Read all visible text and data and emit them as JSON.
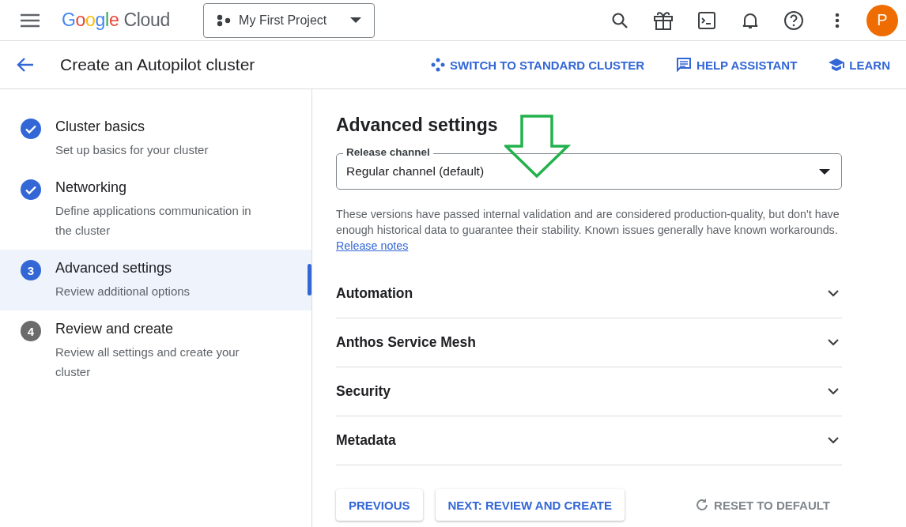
{
  "topbar": {
    "logo": {
      "brand": "Google",
      "product": "Cloud"
    },
    "project": "My First Project",
    "avatar": "P"
  },
  "header": {
    "title": "Create an Autopilot cluster",
    "actions": [
      {
        "kind": "switch",
        "label": "SWITCH TO STANDARD CLUSTER"
      },
      {
        "kind": "help",
        "label": "HELP ASSISTANT"
      },
      {
        "kind": "learn",
        "label": "LEARN"
      }
    ]
  },
  "steps": [
    {
      "title": "Cluster basics",
      "subtitle": "Set up basics for your cluster",
      "kind": "done",
      "selected": false
    },
    {
      "title": "Networking",
      "subtitle": "Define applications communication in the cluster",
      "kind": "done",
      "selected": false
    },
    {
      "title": "Advanced settings",
      "subtitle": "Review additional options",
      "kind": "current",
      "number": "3",
      "selected": true
    },
    {
      "title": "Review and create",
      "subtitle": "Review all settings and create your cluster",
      "kind": "todo",
      "number": "4",
      "selected": false
    }
  ],
  "main": {
    "heading": "Advanced settings",
    "release_channel": {
      "label": "Release channel",
      "value": "Regular channel (default)"
    },
    "description": "These versions have passed internal validation and are considered production-quality, but don't have enough historical data to guarantee their stability. Known issues generally have known workarounds.",
    "link": "Release notes",
    "sections": [
      {
        "label": "Automation",
        "expanded": false
      },
      {
        "label": "Anthos Service Mesh",
        "expanded": false
      },
      {
        "label": "Security",
        "expanded": false
      },
      {
        "label": "Metadata",
        "expanded": false
      }
    ],
    "buttons": [
      {
        "kind": "raised",
        "label": "PREVIOUS"
      },
      {
        "kind": "raised",
        "label": "NEXT: REVIEW AND CREATE"
      },
      {
        "kind": "reset",
        "label": "RESET TO DEFAULT",
        "disabled": true
      }
    ]
  }
}
